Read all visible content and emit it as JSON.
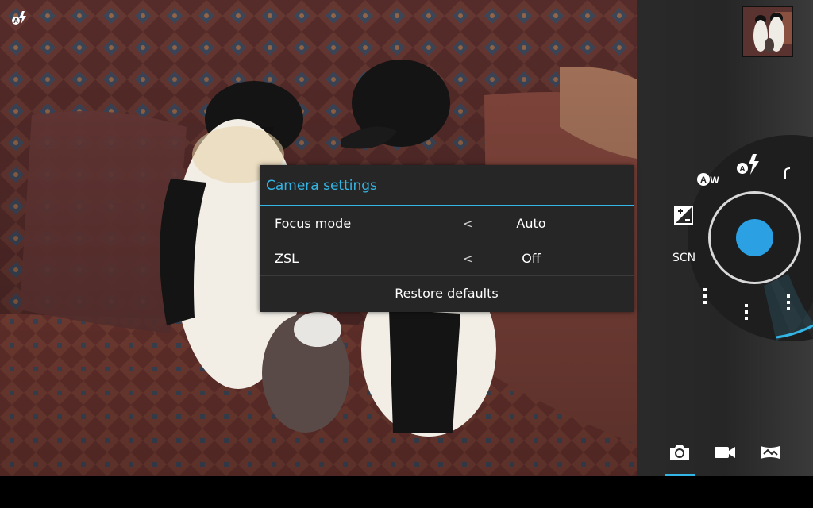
{
  "viewfinder": {
    "flash_icon": "flash-auto-icon"
  },
  "gallery": {
    "thumbnail_icon": "photo-thumbnail"
  },
  "dialog": {
    "title": "Camera settings",
    "rows": [
      {
        "label": "Focus mode",
        "prev": "<",
        "value": "Auto"
      },
      {
        "label": "ZSL",
        "prev": "<",
        "value": "Off"
      }
    ],
    "restore_label": "Restore defaults"
  },
  "controls": {
    "scene_label": "SCN",
    "white_balance_label": "A",
    "white_balance_suffix": "W",
    "flash_label": "A",
    "accent_color": "#33b5e5",
    "shutter_color": "#2ba1e4"
  },
  "modes": {
    "items": [
      "camera-mode-icon",
      "video-mode-icon",
      "panorama-mode-icon"
    ],
    "selected": "camera-mode-icon"
  }
}
